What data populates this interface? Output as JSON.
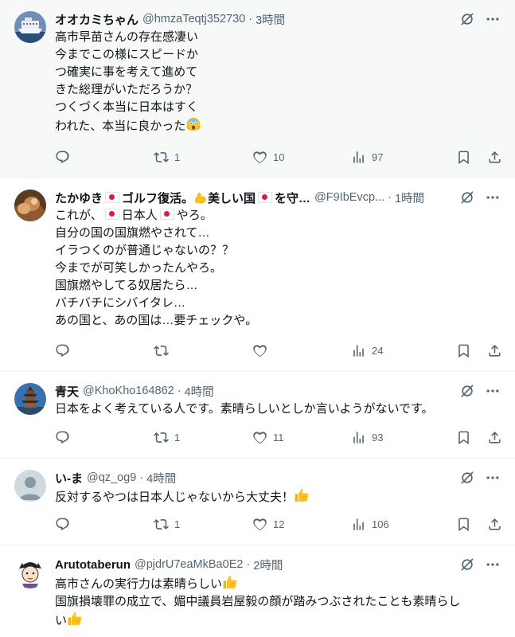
{
  "tweets": [
    {
      "name": "オオカミちゃん",
      "handle": "@hmzaTeqtj352730",
      "time": "3時間",
      "lines": [
        "高市早苗さんの存在感凄い",
        "今までこの様にスピードか",
        "つ確実に事を考えて進めて",
        "きた総理がいただろうか？",
        "つくづく本当に日本はすく",
        "われた、本当に良かった"
      ],
      "reply": "",
      "retweet": "1",
      "like": "10",
      "views": "97"
    },
    {
      "name_a": "たかゆき",
      "name_b": "ゴルフ復活。",
      "name_c": "美しい国",
      "name_d": "を守…",
      "handle": "@F9IbEvcp...",
      "time": "1時間",
      "line1_a": "これが、",
      "line1_b": "日本人",
      "line1_c": "やろ。",
      "lines": [
        "自分の国の国旗燃やされて…",
        "イラつくのが普通じゃないの？？",
        "今までが可笑しかったんやろ。",
        "国旗燃やしてる奴居たら…",
        "バチバチにシバイタレ…",
        "あの国と、あの国は…要チェックや。"
      ],
      "reply": "",
      "retweet": "",
      "like": "",
      "views": "24"
    },
    {
      "name": "青天",
      "handle": "@KhoKho164862",
      "time": "4時間",
      "lines": [
        "日本をよく考えている人です。素晴らしいとしか言いようがないです。"
      ],
      "reply": "",
      "retweet": "1",
      "like": "11",
      "views": "93"
    },
    {
      "name": "い-ま",
      "handle": "@qz_og9",
      "time": "4時間",
      "lines": [
        "反対するやつは日本人じゃないから大丈夫！"
      ],
      "reply": "",
      "retweet": "1",
      "like": "12",
      "views": "106"
    },
    {
      "name": "Arutotaberun",
      "handle": "@pjdrU7eaMkBa0E2",
      "time": "2時間",
      "lines": [
        "高市さんの実行力は素晴らしい",
        "国旗損壊罪の成立で、媚中議員岩屋毅の顔が踏みつぶされたことも素晴らし",
        "い"
      ]
    }
  ],
  "separator": "·"
}
